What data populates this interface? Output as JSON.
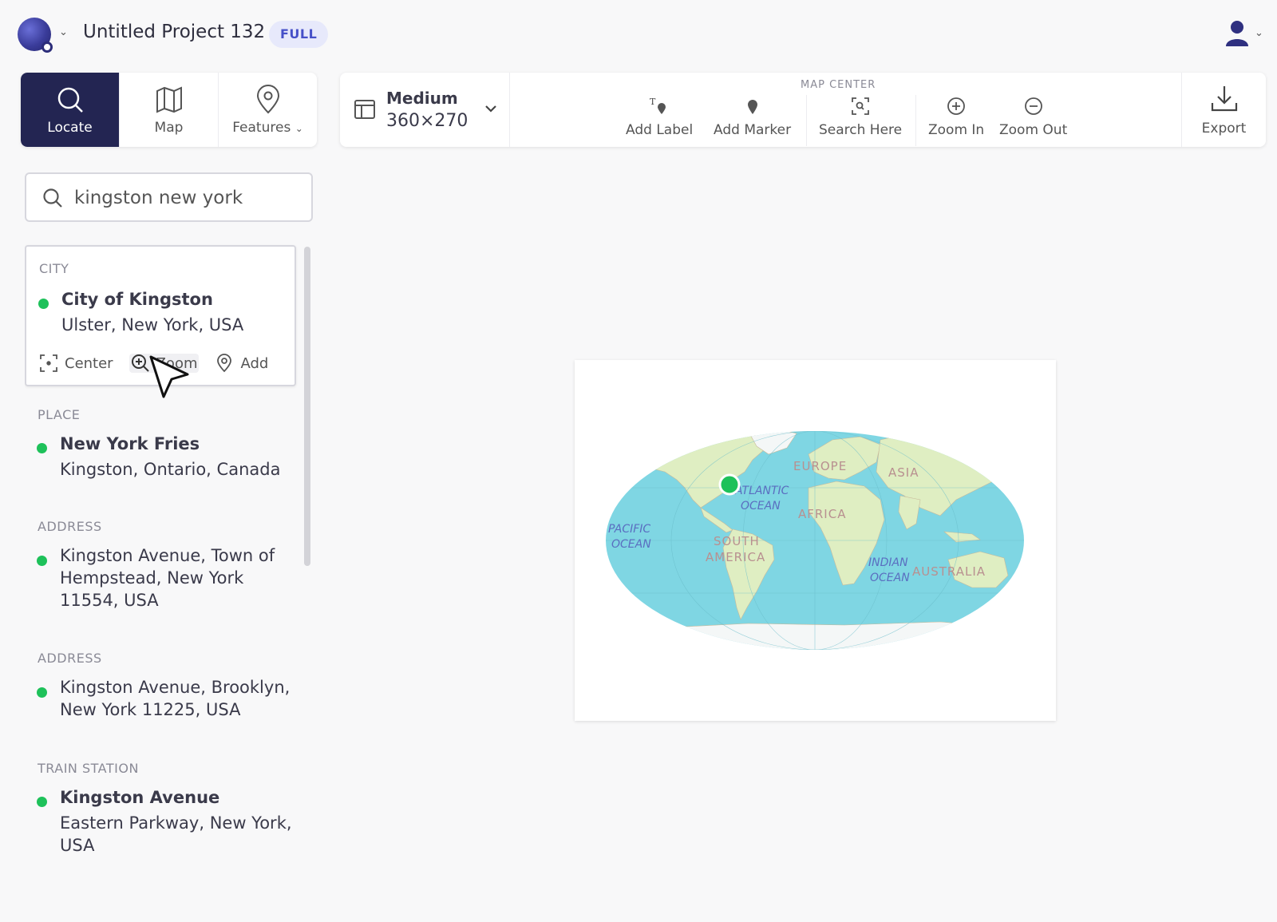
{
  "header": {
    "project_title": "Untitled Project 132",
    "plan_badge": "FULL"
  },
  "nav": {
    "tabs": [
      {
        "label": "Locate",
        "icon": "search-icon",
        "active": true
      },
      {
        "label": "Map",
        "icon": "map-icon",
        "active": false
      },
      {
        "label": "Features",
        "icon": "pin-icon",
        "active": false
      }
    ]
  },
  "toolbar": {
    "size_name": "Medium",
    "size_dims": "360×270",
    "map_center_label": "MAP CENTER",
    "tools": [
      {
        "label": "Add Label",
        "icon": "label-pin-icon"
      },
      {
        "label": "Add Marker",
        "icon": "marker-icon"
      },
      {
        "label": "Search Here",
        "icon": "search-here-icon"
      },
      {
        "label": "Zoom In",
        "icon": "zoom-in-icon"
      },
      {
        "label": "Zoom Out",
        "icon": "zoom-out-icon"
      }
    ],
    "export_label": "Export"
  },
  "search": {
    "value": "kingston new york"
  },
  "results": [
    {
      "category": "CITY",
      "name": "City of Kingston",
      "subtitle": "Ulster, New York, USA",
      "selected": true,
      "actions": [
        "Center",
        "Zoom",
        "Add"
      ]
    },
    {
      "category": "PLACE",
      "name": "New York Fries",
      "subtitle": "Kingston, Ontario, Canada"
    },
    {
      "category": "ADDRESS",
      "name": "",
      "subtitle": "Kingston Avenue, Town of Hempstead, New York 11554, USA"
    },
    {
      "category": "ADDRESS",
      "name": "",
      "subtitle": "Kingston Avenue, Brooklyn, New York 11225, USA"
    },
    {
      "category": "TRAIN STATION",
      "name": "Kingston Avenue",
      "subtitle": "Eastern Parkway, New York, USA"
    }
  ],
  "map": {
    "labels": {
      "europe": "EUROPE",
      "asia": "ASIA",
      "africa": "AFRICA",
      "south_america_1": "SOUTH",
      "south_america_2": "AMERICA",
      "australia": "AUSTRALIA",
      "atlantic_1": "ATLANTIC",
      "atlantic_2": "OCEAN",
      "pacific_1": "PACIFIC",
      "pacific_2": "OCEAN",
      "indian_1": "INDIAN",
      "indian_2": "OCEAN"
    },
    "colors": {
      "ocean": "#7fd6e3",
      "land": "#dfeec2",
      "marker": "#1ec15a"
    }
  }
}
